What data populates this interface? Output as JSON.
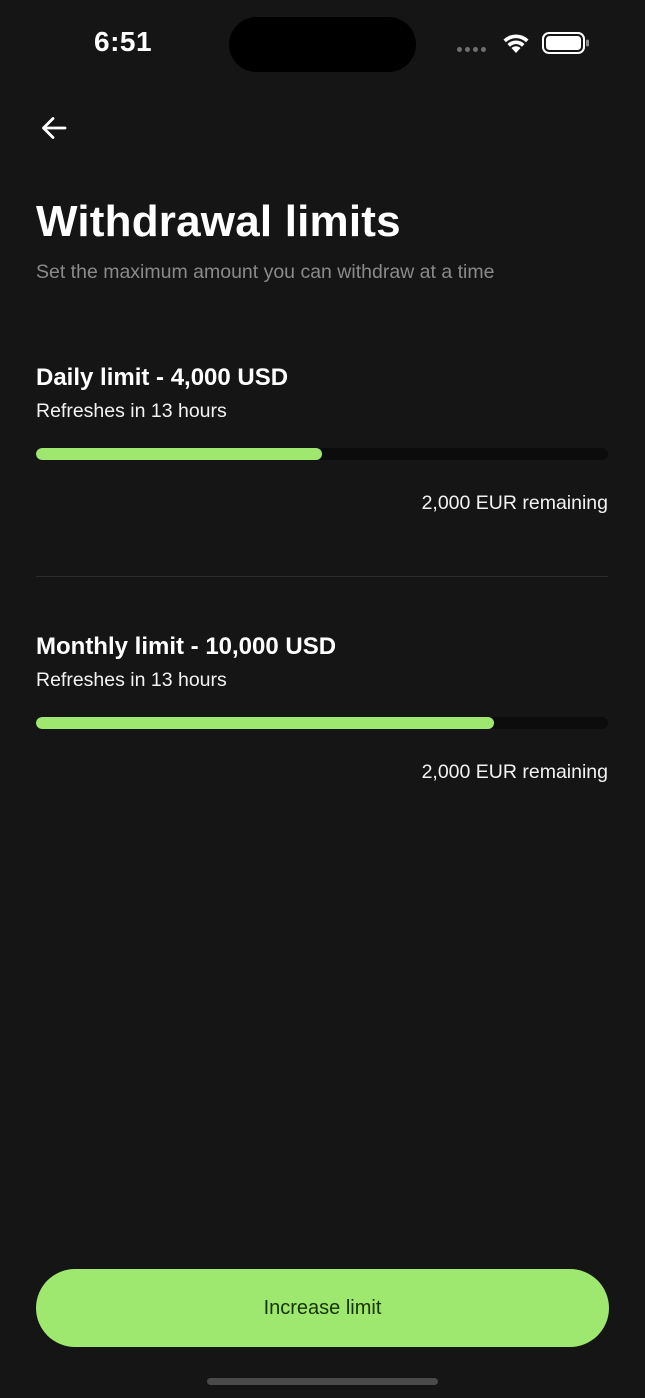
{
  "status_bar": {
    "time": "6:51",
    "icons": [
      "cellular-dots-icon",
      "wifi-icon",
      "battery-icon"
    ]
  },
  "nav": {
    "back_icon": "arrow-left-icon"
  },
  "header": {
    "title": "Withdrawal limits",
    "subtitle": "Set the maximum amount you can withdraw at a time"
  },
  "limits": [
    {
      "title": "Daily limit - 4,000 USD",
      "refresh": "Refreshes in 13 hours",
      "remaining": "2,000 EUR remaining",
      "progress": 0.5
    },
    {
      "title": "Monthly limit - 10,000 USD",
      "refresh": "Refreshes in 13 hours",
      "remaining": "2,000 EUR remaining",
      "progress": 0.8
    }
  ],
  "footer": {
    "cta_label": "Increase limit"
  },
  "colors": {
    "background": "#151515",
    "accent": "#9fe870",
    "cta_text": "#163300",
    "muted_text": "#8a8a8a",
    "track": "#0c0c0c"
  }
}
